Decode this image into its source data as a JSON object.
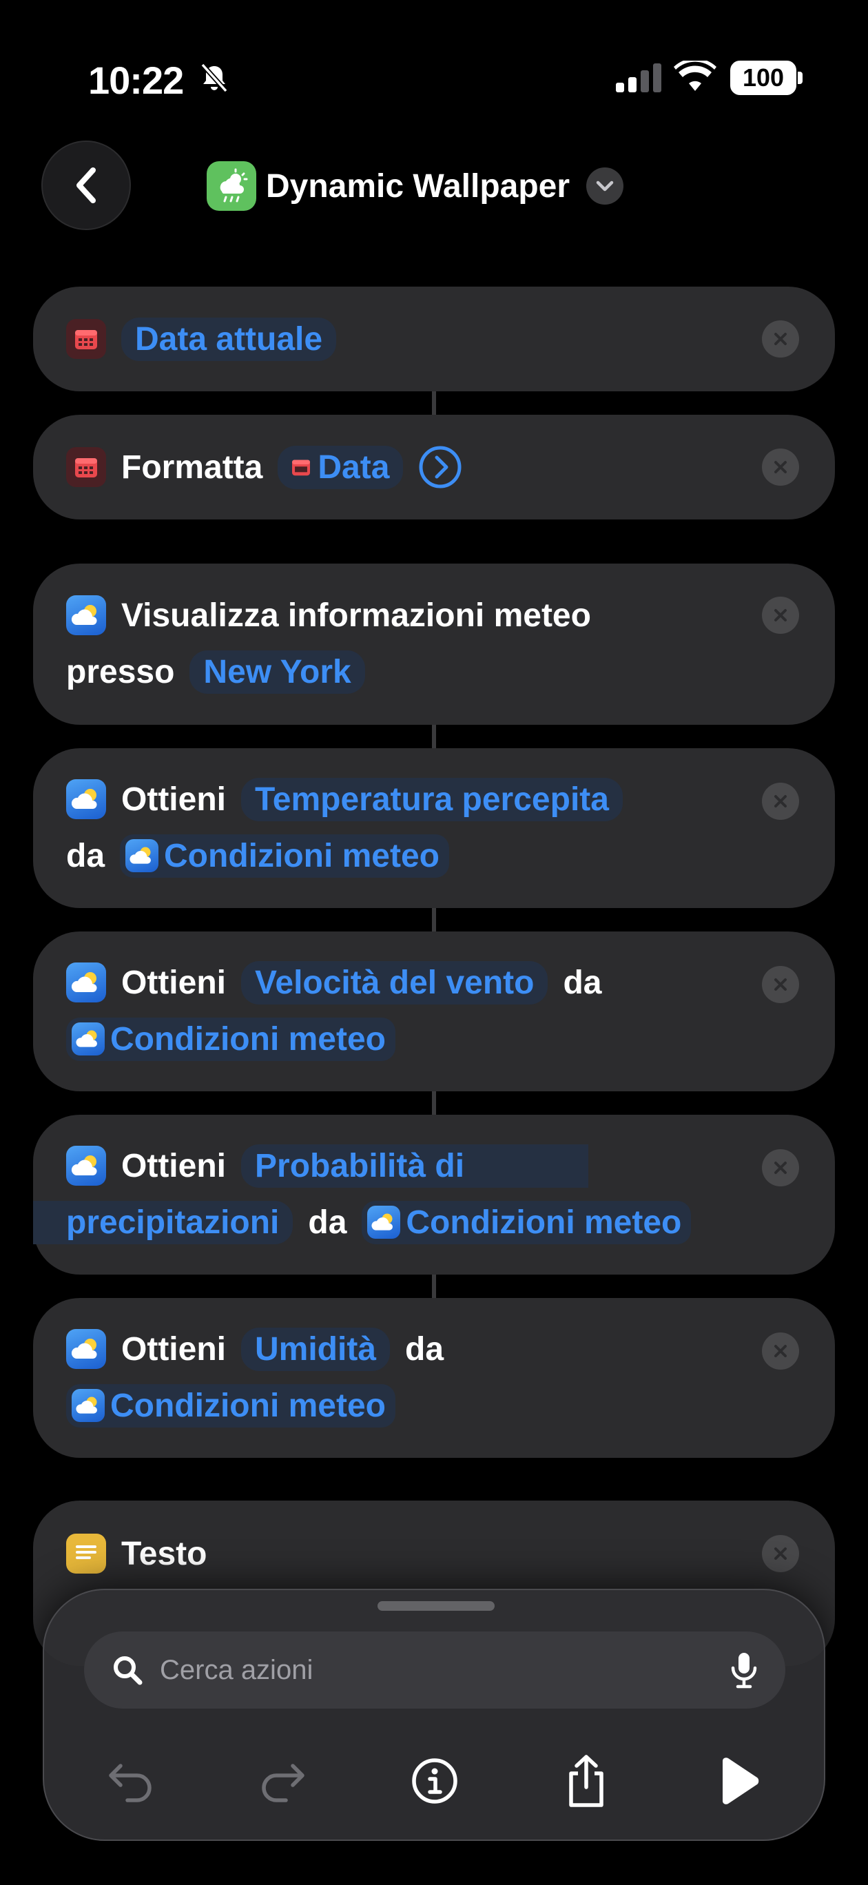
{
  "status": {
    "time": "10:22",
    "battery": "100"
  },
  "header": {
    "title": "Dynamic Wallpaper"
  },
  "actions": [
    {
      "ref": "Data attuale"
    },
    {
      "verb": "Formatta",
      "ref": "Data"
    },
    {
      "line1": "Visualizza informazioni meteo",
      "prep": "presso",
      "ref": "New York"
    },
    {
      "verb": "Ottieni",
      "prop": "Temperatura percepita",
      "prep": "da",
      "ref": "Condizioni meteo"
    },
    {
      "verb": "Ottieni",
      "prop": "Velocità del vento",
      "prep": "da",
      "ref": "Condizioni meteo"
    },
    {
      "verb": "Ottieni",
      "prop_a": "Probabilità di",
      "prop_b": "precipitazioni",
      "prep": "da",
      "ref": "Condizioni meteo"
    },
    {
      "verb": "Ottieni",
      "prop": "Umidità",
      "prep": "da",
      "ref": "Condizioni meteo"
    },
    {
      "verb": "Testo"
    }
  ],
  "search": {
    "placeholder": "Cerca azioni"
  },
  "colors": {
    "accent": "#3d8ef5",
    "card": "#2c2c2e",
    "background": "#000000"
  },
  "icons": {
    "back": "chevron-left-icon",
    "app": "weather-icon",
    "calendar": "calendar-icon",
    "weather": "partly-cloudy-icon",
    "text": "text-lines-icon",
    "close": "close-icon",
    "search": "search-icon",
    "mic": "microphone-icon",
    "undo": "undo-icon",
    "redo": "redo-icon",
    "info": "info-icon",
    "share": "share-icon",
    "play": "play-icon"
  }
}
